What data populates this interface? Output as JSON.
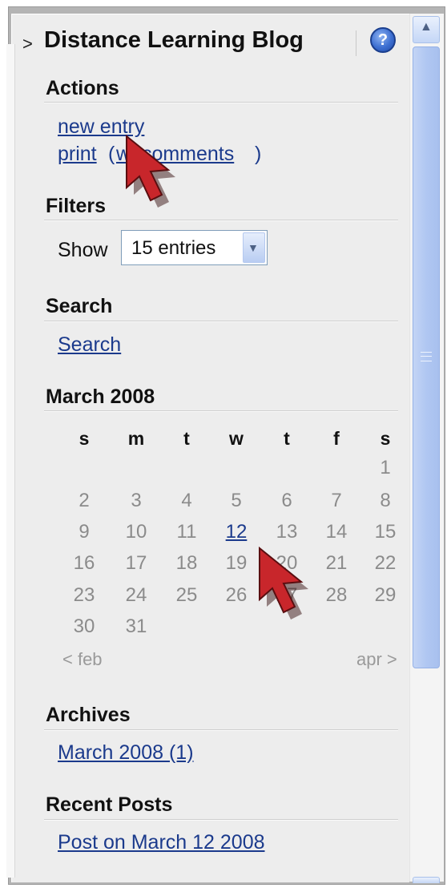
{
  "panel": {
    "title": "Distance Learning Blog",
    "expand_glyph": ">",
    "help_glyph": "?"
  },
  "actions": {
    "title": "Actions",
    "new_entry": "new entry",
    "print": "print",
    "print_paren_open": "(",
    "with_comments": "w/ comments",
    "print_paren_close": ")"
  },
  "filters": {
    "title": "Filters",
    "show_label": "Show",
    "entries_selected": "15 entries"
  },
  "search": {
    "title": "Search",
    "link": "Search"
  },
  "calendar": {
    "title": "March 2008",
    "weekdays": [
      "s",
      "m",
      "t",
      "w",
      "t",
      "f",
      "s"
    ],
    "weeks": [
      [
        "",
        "",
        "",
        "",
        "",
        "",
        "1"
      ],
      [
        "2",
        "3",
        "4",
        "5",
        "6",
        "7",
        "8"
      ],
      [
        "9",
        "10",
        "11",
        "12",
        "13",
        "14",
        "15"
      ],
      [
        "16",
        "17",
        "18",
        "19",
        "20",
        "21",
        "22"
      ],
      [
        "23",
        "24",
        "25",
        "26",
        "27",
        "28",
        "29"
      ],
      [
        "30",
        "31",
        "",
        "",
        "",
        "",
        ""
      ]
    ],
    "linked_day": "12",
    "prev": "< feb",
    "next": "apr >"
  },
  "archives": {
    "title": "Archives",
    "link": "March 2008 (1)"
  },
  "recent_posts": {
    "title": "Recent Posts",
    "link": "Post on March 12 2008"
  },
  "icons": {
    "help": "help-icon",
    "cursor": "mouse-cursor-icon",
    "scroll_up": "scroll-up-arrow-icon",
    "dropdown": "chevron-down-icon"
  },
  "colors": {
    "link": "#1b3a8c",
    "cursor": "#c8262b",
    "scroll_thumb": "#b0c7f2"
  }
}
